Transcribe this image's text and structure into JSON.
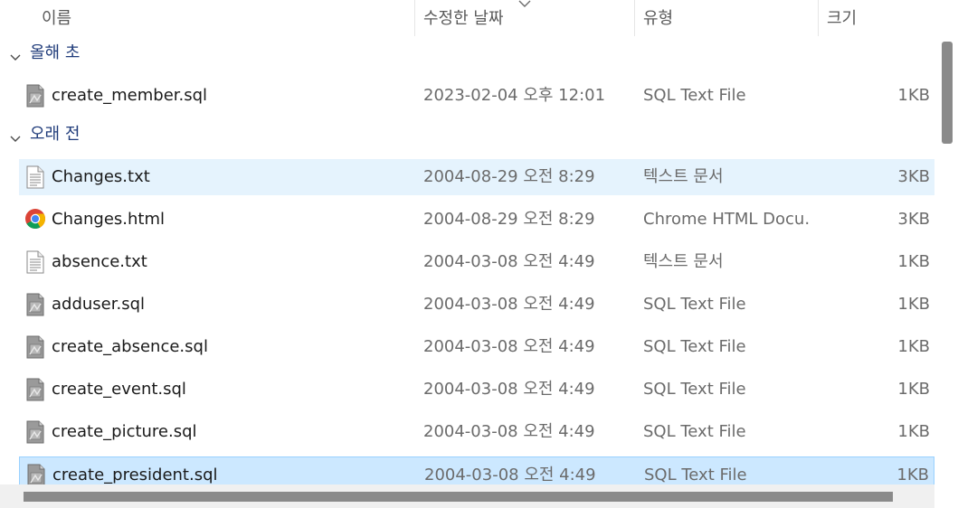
{
  "columns": {
    "name": "이름",
    "modified": "수정한 날짜",
    "type": "유형",
    "size": "크기"
  },
  "groups": [
    {
      "label": "올해 초",
      "files": [
        {
          "name": "create_member.sql",
          "date": "2023-02-04 오후 12:01",
          "type": "SQL Text File",
          "size": "1KB",
          "icon": "sql-file-icon",
          "state": "normal"
        }
      ]
    },
    {
      "label": "오래 전",
      "files": [
        {
          "name": "Changes.txt",
          "date": "2004-08-29 오전 8:29",
          "type": "텍스트 문서",
          "size": "3KB",
          "icon": "text-file-icon",
          "state": "hover"
        },
        {
          "name": "Changes.html",
          "date": "2004-08-29 오전 8:29",
          "type": "Chrome HTML Docu...",
          "size": "3KB",
          "icon": "chrome-icon",
          "state": "normal"
        },
        {
          "name": "absence.txt",
          "date": "2004-03-08 오전 4:49",
          "type": "텍스트 문서",
          "size": "1KB",
          "icon": "text-file-icon",
          "state": "normal"
        },
        {
          "name": "adduser.sql",
          "date": "2004-03-08 오전 4:49",
          "type": "SQL Text File",
          "size": "1KB",
          "icon": "sql-file-icon",
          "state": "normal"
        },
        {
          "name": "create_absence.sql",
          "date": "2004-03-08 오전 4:49",
          "type": "SQL Text File",
          "size": "1KB",
          "icon": "sql-file-icon",
          "state": "normal"
        },
        {
          "name": "create_event.sql",
          "date": "2004-03-08 오전 4:49",
          "type": "SQL Text File",
          "size": "1KB",
          "icon": "sql-file-icon",
          "state": "normal"
        },
        {
          "name": "create_picture.sql",
          "date": "2004-03-08 오전 4:49",
          "type": "SQL Text File",
          "size": "1KB",
          "icon": "sql-file-icon",
          "state": "normal"
        },
        {
          "name": "create_president.sql",
          "date": "2004-03-08 오전 4:49",
          "type": "SQL Text File",
          "size": "1KB",
          "icon": "sql-file-icon",
          "state": "selected"
        }
      ]
    }
  ],
  "colors": {
    "hover": "#e5f3fd",
    "selected": "#cce8ff",
    "selected_border": "#99d1ff",
    "group_text": "#1f3b7a"
  }
}
